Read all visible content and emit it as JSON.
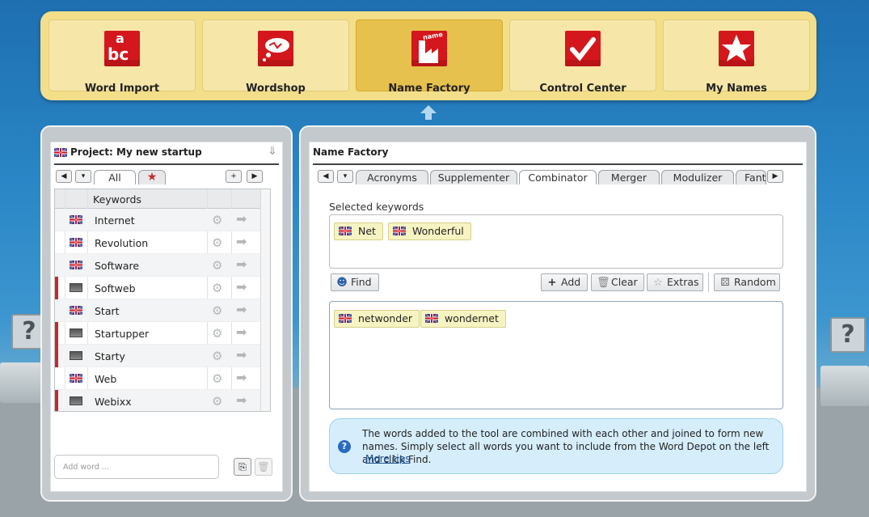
{
  "nav": {
    "items": [
      {
        "label": "Word Import",
        "active": false
      },
      {
        "label": "Wordshop",
        "active": false
      },
      {
        "label": "Name Factory",
        "active": true
      },
      {
        "label": "Control Center",
        "active": false
      },
      {
        "label": "My Names",
        "active": false
      }
    ],
    "icon_texts": {
      "abc_top": "a",
      "abc_bottom": "bc",
      "name": "name"
    }
  },
  "left_panel": {
    "title": "Project: My new startup",
    "tabs": {
      "all_label": "All"
    },
    "table": {
      "header": "Keywords",
      "rows": [
        {
          "word": "Internet",
          "flag": "uk",
          "marked": false
        },
        {
          "word": "Revolution",
          "flag": "uk",
          "marked": false
        },
        {
          "word": "Software",
          "flag": "uk",
          "marked": false
        },
        {
          "word": "Softweb",
          "flag": "generic",
          "marked": true
        },
        {
          "word": "Start",
          "flag": "uk",
          "marked": false
        },
        {
          "word": "Startupper",
          "flag": "generic",
          "marked": true
        },
        {
          "word": "Starty",
          "flag": "generic",
          "marked": true
        },
        {
          "word": "Web",
          "flag": "uk",
          "marked": false
        },
        {
          "word": "Webixx",
          "flag": "generic",
          "marked": true
        }
      ]
    },
    "add_word_placeholder": "Add word ..."
  },
  "right_panel": {
    "title": "Name Factory",
    "tabs": [
      "Acronyms",
      "Supplementer",
      "Combinator",
      "Merger",
      "Modulizer",
      "Fant"
    ],
    "active_tab": "Combinator",
    "selected_keywords_label": "Selected keywords",
    "selected_keywords": [
      "Net",
      "Wonderful"
    ],
    "buttons": {
      "find": "Find",
      "add": "Add",
      "clear": "Clear",
      "extras": "Extras",
      "random": "Random"
    },
    "results": [
      "netwonder",
      "wondernet"
    ],
    "info": {
      "text": "The words added to the tool are combined with each other and joined to form new names. Simply select all words you want to include from the Word Depot on the left and click Find.",
      "link": "More tips"
    }
  },
  "colors": {
    "accent_red": "#d4171c",
    "nav_bg": "#f3de8a",
    "nav_active": "#e6c14d"
  }
}
